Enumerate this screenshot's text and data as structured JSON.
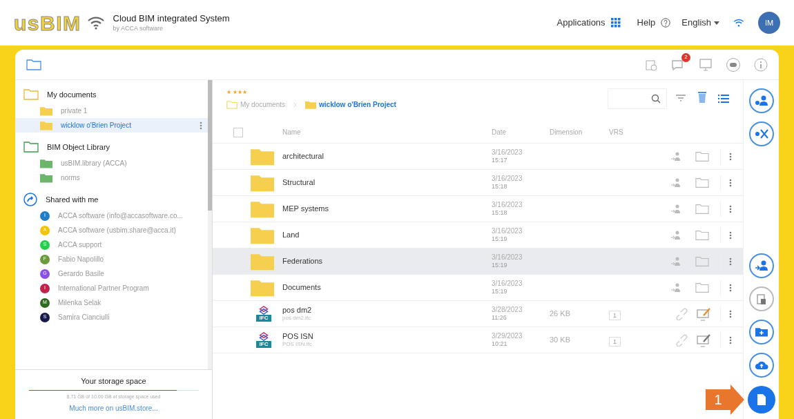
{
  "header": {
    "logo": "usBIM",
    "title": "Cloud BIM integrated System",
    "subtitle": "by ACCA software",
    "applications": "Applications",
    "help": "Help",
    "language": "English",
    "avatar": "IM"
  },
  "toolbar": {
    "notifications": "2"
  },
  "sidebar": {
    "sections": [
      {
        "kind": "docs",
        "title": "My documents",
        "items": [
          {
            "label": "private 1",
            "selected": false
          },
          {
            "label": "wicklow o'Brien Project",
            "selected": true
          }
        ]
      },
      {
        "kind": "library",
        "title": "BIM Object Library",
        "items": [
          {
            "label": "usBIM.library (ACCA)",
            "selected": false
          },
          {
            "label": "norms",
            "selected": false
          }
        ]
      },
      {
        "kind": "shared",
        "title": "Shared with me",
        "items": [
          {
            "label": "ACCA software (info@accasoftware.co...",
            "initial": "I",
            "color": "#1e7fc8",
            "selected": false
          },
          {
            "label": "ACCA software (usbim.share@acca.it)",
            "initial": "A",
            "color": "#f5c400",
            "selected": false
          },
          {
            "label": "ACCA support",
            "initial": "S",
            "color": "#22d04a",
            "selected": false
          },
          {
            "label": "Fabio Napolillo",
            "initial": "F",
            "color": "#6b9a3a",
            "selected": false
          },
          {
            "label": "Gerardo Basile",
            "initial": "G",
            "color": "#8a4fe8",
            "selected": false
          },
          {
            "label": "International Partner Program",
            "initial": "I",
            "color": "#c0224a",
            "selected": false
          },
          {
            "label": "Milenka Selak",
            "initial": "M",
            "color": "#2f6b1e",
            "selected": false
          },
          {
            "label": "Samira Cianciulli",
            "initial": "S",
            "color": "#151a4a",
            "selected": false
          }
        ]
      }
    ],
    "storage": {
      "title": "Your storage space",
      "level": 0.87,
      "usage": "8.71 GB of 10.00 GB of storage space used",
      "link": "Much more on usBIM.store..."
    }
  },
  "main": {
    "stars": "★ ★★★",
    "breadcrumb": [
      {
        "label": "My documents",
        "selected": false
      },
      {
        "label": "wicklow o'Brien Project",
        "selected": true
      }
    ],
    "select_all": {
      "checked": false
    },
    "columns": [
      "Name",
      "Date",
      "Dimension",
      "VRS"
    ],
    "rows": [
      {
        "kind": "folder",
        "name": "architectural",
        "date": "3/16/2023",
        "time": "15:17",
        "selected": false
      },
      {
        "kind": "folder",
        "name": "Structural",
        "date": "3/16/2023",
        "time": "15:18",
        "selected": false
      },
      {
        "kind": "folder",
        "name": "MEP systems",
        "date": "3/16/2023",
        "time": "15:18",
        "selected": false
      },
      {
        "kind": "folder",
        "name": "Land",
        "date": "3/16/2023",
        "time": "15:19",
        "selected": false
      },
      {
        "kind": "folder",
        "name": "Federations",
        "date": "3/16/2023",
        "time": "15:19",
        "selected": true
      },
      {
        "kind": "folder",
        "name": "Documents",
        "date": "3/16/2023",
        "time": "15:19",
        "selected": false
      },
      {
        "kind": "file",
        "name": "pos dm2",
        "file": "pos dm2.ifc",
        "badge": "IFC",
        "date": "3/28/2023",
        "time": "11:26",
        "size": "26 KB",
        "vrs": "1",
        "edited": true,
        "selected": false
      },
      {
        "kind": "file",
        "name": "POS ISN",
        "file": "POS ISN.ifc",
        "badge": "IFC",
        "date": "3/29/2023",
        "time": "10:21",
        "size": "30 KB",
        "vrs": "1",
        "edited": false,
        "selected": false
      }
    ]
  },
  "callout": "1"
}
